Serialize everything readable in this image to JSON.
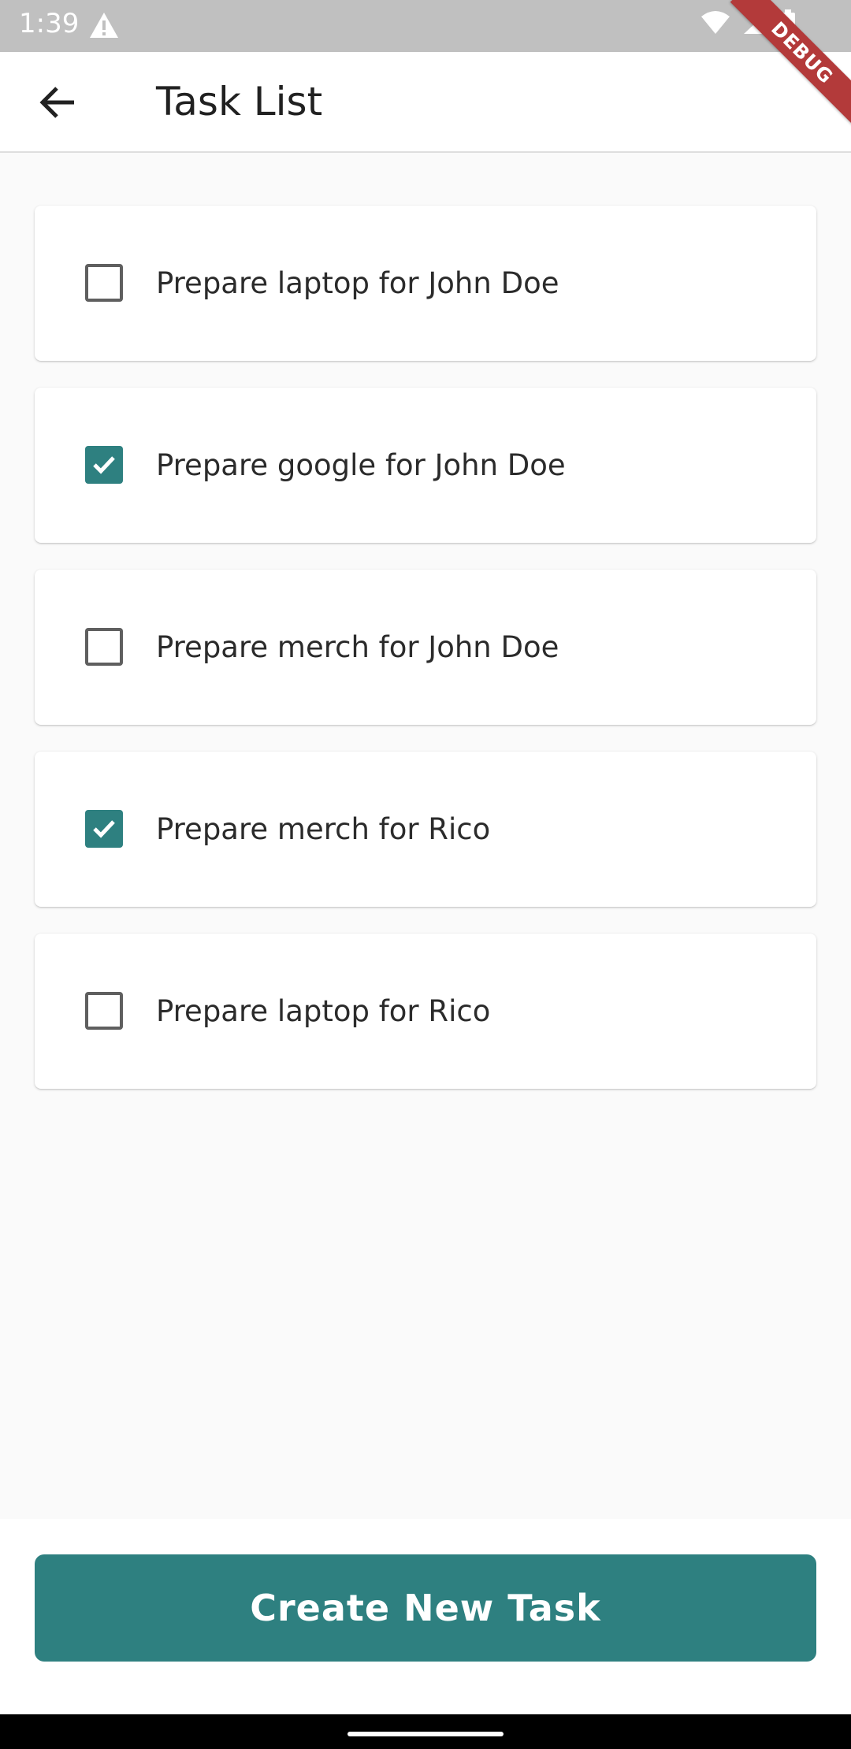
{
  "status_bar": {
    "time": "1:39"
  },
  "debug_banner": "DEBUG",
  "app_bar": {
    "title": "Task List"
  },
  "tasks": [
    {
      "label": "Prepare laptop for John Doe",
      "checked": false
    },
    {
      "label": "Prepare google for John Doe",
      "checked": true
    },
    {
      "label": "Prepare merch for John Doe",
      "checked": false
    },
    {
      "label": "Prepare merch for Rico",
      "checked": true
    },
    {
      "label": "Prepare laptop for Rico",
      "checked": false
    }
  ],
  "create_button": {
    "label": "Create New Task"
  },
  "colors": {
    "accent": "#2e8080",
    "status_bar": "#c0c0c0",
    "debug": "#b33a3a"
  },
  "icons": [
    "warning-icon",
    "wifi-icon",
    "signal-icon",
    "battery-icon",
    "back-arrow-icon",
    "checkmark-icon"
  ]
}
